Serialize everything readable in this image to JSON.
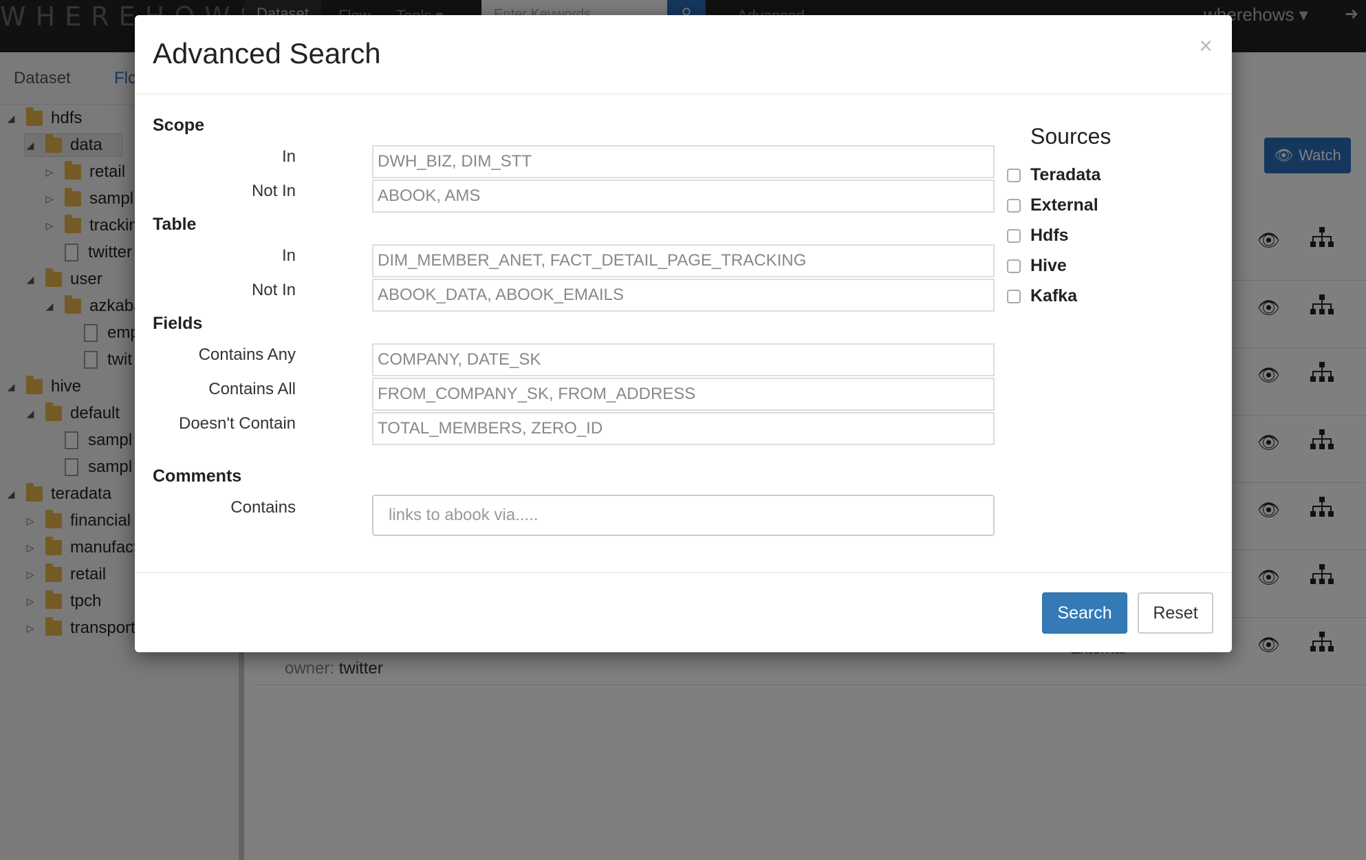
{
  "topnav": {
    "brand": "WHEREHOWS",
    "links": [
      "Dataset",
      "Flow",
      "Tools ▾"
    ],
    "search_placeholder": "Enter Keywords",
    "search_icon": "search-icon",
    "advanced_link": "Advanced",
    "user": "wherehows ▾",
    "logout_icon": "logout-icon"
  },
  "sidebar": {
    "tabs": [
      "Dataset",
      "Flo"
    ],
    "tree": [
      {
        "label": "hdfs",
        "type": "folder",
        "depth": 0,
        "expanded": true
      },
      {
        "label": "data",
        "type": "folder",
        "depth": 1,
        "expanded": true,
        "selected": true
      },
      {
        "label": "retail",
        "type": "folder",
        "depth": 2,
        "expanded": false
      },
      {
        "label": "sampl",
        "type": "folder",
        "depth": 2,
        "expanded": false
      },
      {
        "label": "trackin",
        "type": "folder",
        "depth": 2,
        "expanded": false
      },
      {
        "label": "twitter",
        "type": "file",
        "depth": 2
      },
      {
        "label": "user",
        "type": "folder",
        "depth": 1,
        "expanded": true
      },
      {
        "label": "azkaba",
        "type": "folder",
        "depth": 2,
        "expanded": true
      },
      {
        "label": "emp",
        "type": "file",
        "depth": 3
      },
      {
        "label": "twit",
        "type": "file",
        "depth": 3
      },
      {
        "label": "hive",
        "type": "folder",
        "depth": 0,
        "expanded": true
      },
      {
        "label": "default",
        "type": "folder",
        "depth": 1,
        "expanded": true
      },
      {
        "label": "sampl",
        "type": "file",
        "depth": 2
      },
      {
        "label": "sampl",
        "type": "file",
        "depth": 2
      },
      {
        "label": "teradata",
        "type": "folder",
        "depth": 0,
        "expanded": true
      },
      {
        "label": "financial",
        "type": "folder",
        "depth": 1,
        "expanded": false
      },
      {
        "label": "manufact",
        "type": "folder",
        "depth": 1,
        "expanded": false
      },
      {
        "label": "retail",
        "type": "folder",
        "depth": 1,
        "expanded": false
      },
      {
        "label": "tpch",
        "type": "folder",
        "depth": 1,
        "expanded": false
      },
      {
        "label": "transport",
        "type": "folder",
        "depth": 1,
        "expanded": false
      }
    ]
  },
  "main": {
    "watch_label": "Watch",
    "owner_label": "owner:",
    "owner_value": "twitter",
    "last_row_text": "External"
  },
  "modal": {
    "title": "Advanced Search",
    "close": "×",
    "scope": {
      "title": "Scope",
      "in_label": "In",
      "in_placeholder": "DWH_BIZ, DIM_STT",
      "not_in_label": "Not In",
      "not_in_placeholder": "ABOOK, AMS"
    },
    "table": {
      "title": "Table",
      "in_label": "In",
      "in_placeholder": "DIM_MEMBER_ANET, FACT_DETAIL_PAGE_TRACKING",
      "not_in_label": "Not In",
      "not_in_placeholder": "ABOOK_DATA, ABOOK_EMAILS"
    },
    "fields": {
      "title": "Fields",
      "any_label": "Contains Any",
      "any_placeholder": "COMPANY, DATE_SK",
      "all_label": "Contains All",
      "all_placeholder": "FROM_COMPANY_SK, FROM_ADDRESS",
      "not_label": "Doesn't Contain",
      "not_placeholder": "TOTAL_MEMBERS, ZERO_ID"
    },
    "comments": {
      "title": "Comments",
      "contains_label": "Contains",
      "contains_placeholder": "links to abook via....."
    },
    "sources": {
      "title": "Sources",
      "items": [
        "Teradata",
        "External",
        "Hdfs",
        "Hive",
        "Kafka"
      ]
    },
    "footer": {
      "search_label": "Search",
      "reset_label": "Reset"
    }
  }
}
